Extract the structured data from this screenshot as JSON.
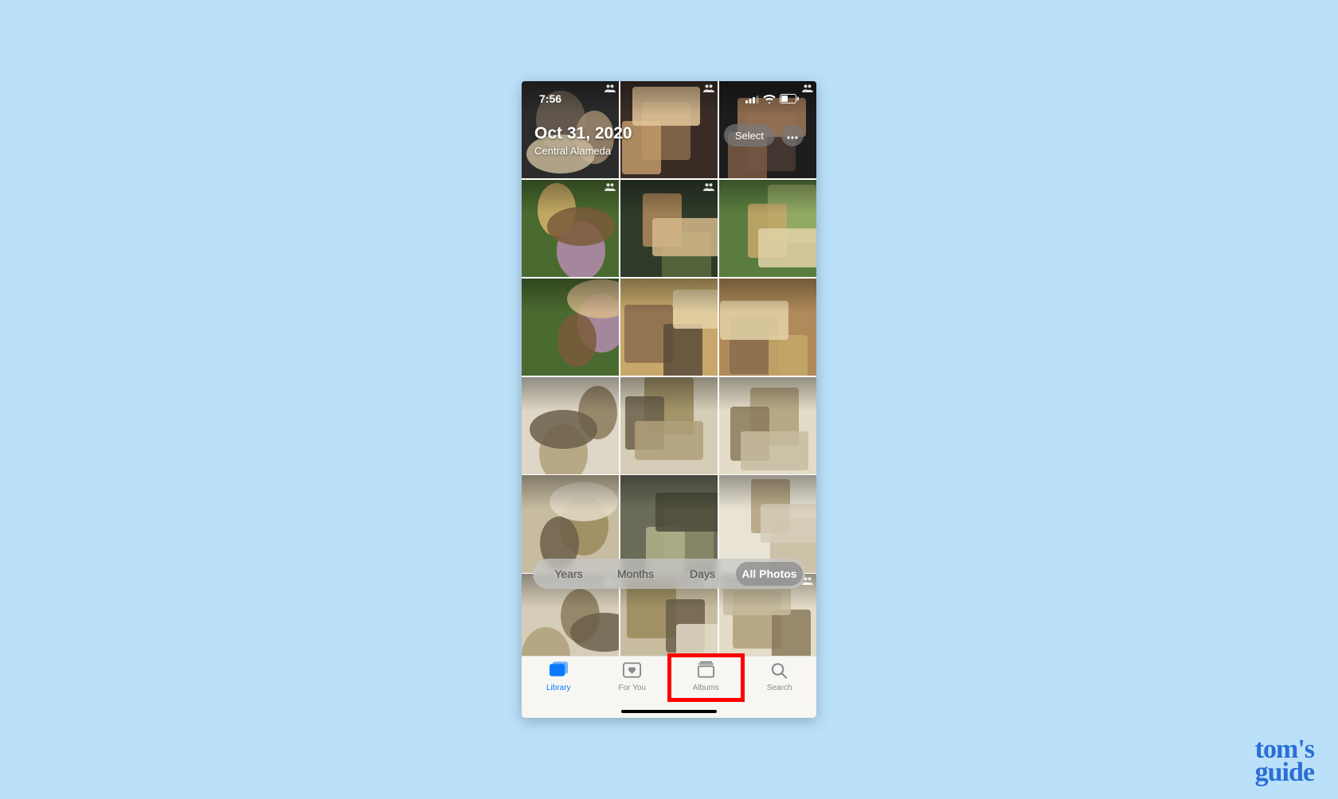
{
  "status_bar": {
    "time": "7:56"
  },
  "header": {
    "date": "Oct 31, 2020",
    "location": "Central Alameda",
    "select_label": "Select"
  },
  "segmented": {
    "items": [
      "Years",
      "Months",
      "Days",
      "All Photos"
    ],
    "active_index": 3
  },
  "tabs": [
    {
      "label": "Library"
    },
    {
      "label": "For You"
    },
    {
      "label": "Albums"
    },
    {
      "label": "Search"
    }
  ],
  "active_tab_index": 0,
  "highlighted_tab_index": 2,
  "thumbs": [
    {
      "people": true
    },
    {
      "people": true
    },
    {
      "people": true
    },
    {
      "people": true
    },
    {
      "people": true
    },
    {
      "people": false
    },
    {
      "people": false
    },
    {
      "people": false
    },
    {
      "people": false
    },
    {
      "people": false
    },
    {
      "people": false
    },
    {
      "people": false
    },
    {
      "people": false
    },
    {
      "people": false
    },
    {
      "people": false
    },
    {
      "people": true
    },
    {
      "people": true
    },
    {
      "people": true
    }
  ],
  "watermark": {
    "line1": "tom's",
    "line2": "guide"
  }
}
